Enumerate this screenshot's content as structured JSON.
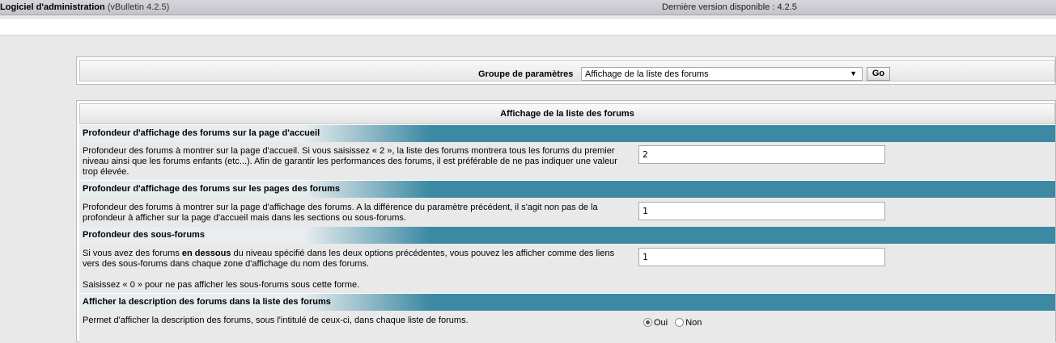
{
  "header": {
    "app_name": "Logiciel d'administration",
    "version": "(vBulletin 4.2.5)",
    "latest_version": "Dernière version disponible : 4.2.5"
  },
  "selector": {
    "label": "Groupe de paramètres",
    "selected": "Affichage de la liste des forums",
    "go_label": "Go"
  },
  "settings": {
    "title": "Affichage de la liste des forums",
    "items": [
      {
        "title": "Profondeur d'affichage des forums sur la page d'accueil",
        "description": "Profondeur des forums à montrer sur la page d'accueil. Si vous saisissez « 2 », la liste des forums montrera tous les forums du premier niveau ainsi que les forums enfants (etc...). Afin de garantir les performances des forums, il est préférable de ne pas indiquer une valeur trop élevée.",
        "value": "2"
      },
      {
        "title": "Profondeur d'affichage des forums sur les pages des forums",
        "description": "Profondeur des forums à montrer sur la page d'affichage des forums. A la différence du paramètre précédent, il s'agit non pas de la profondeur à afficher sur la page d'accueil mais dans les sections ou sous-forums.",
        "value": "1"
      },
      {
        "title": "Profondeur des sous-forums",
        "description_pre": "Si vous avez des forums ",
        "description_bold": "en dessous",
        "description_post": " du niveau spécifié dans les deux options précédentes, vous pouvez les afficher comme des liens vers des sous-forums dans chaque zone d'affichage du nom des forums.",
        "note": "Saisissez « 0 » pour ne pas afficher les sous-forums sous cette forme.",
        "value": "1"
      },
      {
        "title": "Afficher la description des forums dans la liste des forums",
        "description": "Permet d'afficher la description des forums, sous l'intitulé de ceux-ci, dans chaque liste de forums.",
        "options": [
          "Oui",
          "Non"
        ],
        "selected": "Oui"
      }
    ]
  },
  "colors": {
    "section_band": "#3b89a3",
    "page_bg": "#e9e9e9"
  }
}
